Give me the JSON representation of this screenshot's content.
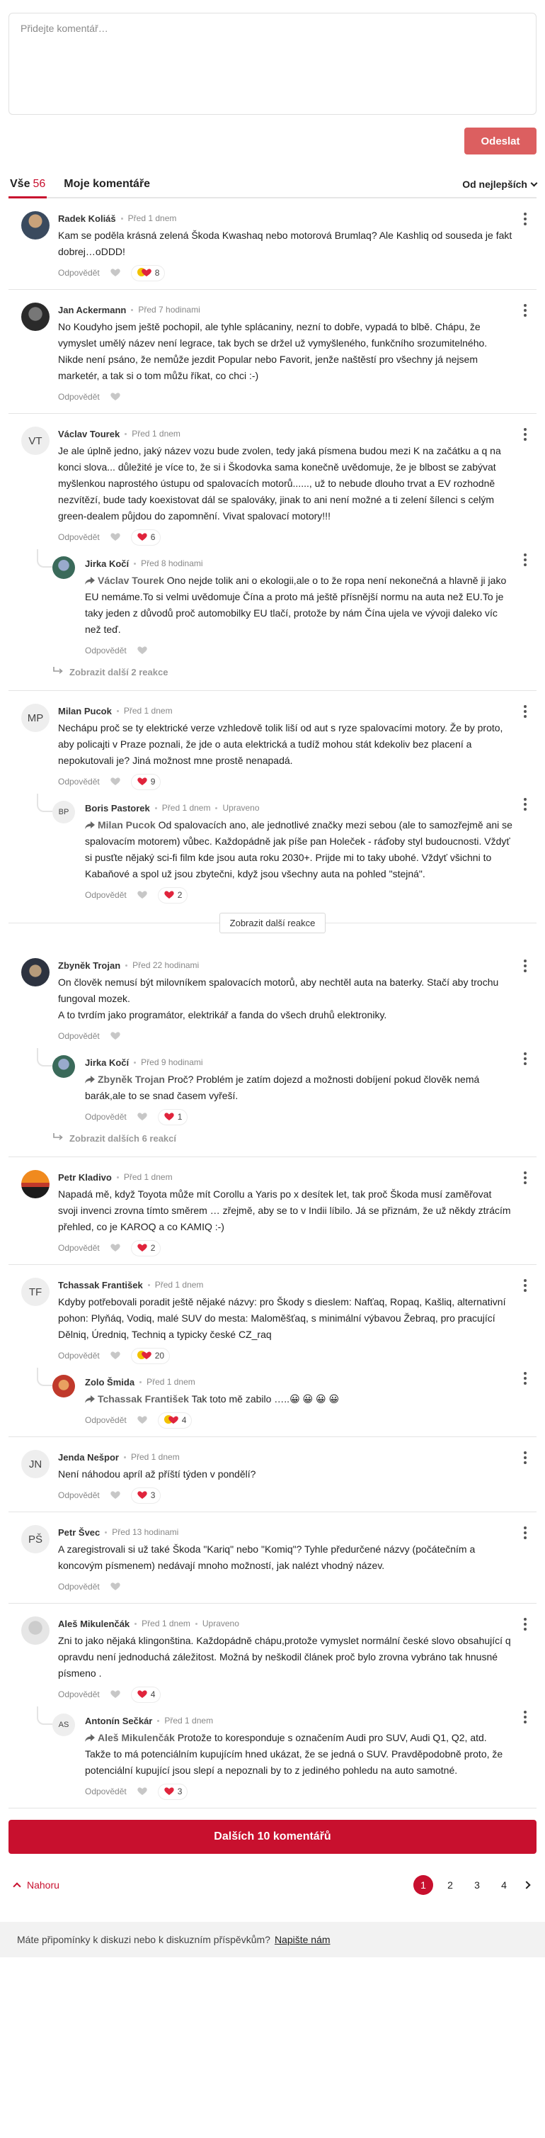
{
  "composer": {
    "placeholder": "Přidejte komentář…",
    "submit_label": "Odeslat"
  },
  "tabs": {
    "all_label": "Vše",
    "all_count": "56",
    "mine_label": "Moje komentáře",
    "sort_label": "Od nejlepších"
  },
  "labels": {
    "reply": "Odpovědět",
    "show_more_inline": "Zobrazit další reakce",
    "edited": "Upraveno"
  },
  "colors": {
    "accent": "#c8102e",
    "submit": "#dc5f60"
  },
  "comments": [
    {
      "author": "Radek Koliáš",
      "time": "Před 1 dnem",
      "text": "Kam se poděla krásná zelená Škoda Kwashaq nebo motorová Brumlaq? Ale Kashliq od souseda je fakt dobrej…oDDD!",
      "reaction": "8",
      "reaction_icon": "mixed"
    },
    {
      "author": "Jan Ackermann",
      "time": "Před 7 hodinami",
      "text": "No Koudyho jsem ještě pochopil, ale tyhle splácaniny, nezní to dobře, vypadá to blbě. Chápu, že vymyslet umělý název není legrace, tak bych se držel už vymyšleného, funkčního srozumitelného. Nikde není psáno, že nemůže jezdit Popular nebo Favorit, jenže naštěstí pro všechny já nejsem marketér, a tak si o tom můžu říkat, co chci :-)"
    },
    {
      "author": "Václav Tourek",
      "initials": "VT",
      "time": "Před 1 dnem",
      "text": "Je ale úplně jedno, jaký název vozu bude zvolen, tedy jaká písmena budou mezi K na začátku a q na konci slova... důležité je více to, že si i Škodovka sama konečně uvědomuje, že je blbost se zabývat myšlenkou naprostého ústupu od spalovacích motorů......, už to nebude dlouho trvat a EV rozhodně nezvítězí, bude tady koexistovat dál se spalováky, jinak to ani není možné a ti zelení šílenci s celým green-dealem půjdou do zapomnění. Vivat spalovací motory!!!",
      "reaction": "6"
    },
    {
      "author": "Jirka Kočí",
      "time": "Před 8 hodinami",
      "mention": "Václav Tourek",
      "text": "Ono nejde tolik ani o ekologii,ale o to že ropa není nekonečná a hlavně ji jako EU nemáme.To si velmi uvědomuje Čína a proto má ještě přísnější normu na auta než EU.To je taky jeden z důvodů proč automobilky EU tlačí, protože by nám Čína ujela ve vývoji daleko víc než teď.",
      "more": "Zobrazit další 2 reakce"
    },
    {
      "author": "Milan Pucok",
      "initials": "MP",
      "time": "Před 1 dnem",
      "text": "Nechápu proč se ty elektrické verze vzhledově tolik liší od aut s ryze spalovacími motory. Že by proto, aby policajti v Praze poznali, že jde o auta elektrická a tudíž mohou stát kdekoliv bez placení a nepokutovali je? Jiná možnost mne prostě nenapadá.",
      "reaction": "9"
    },
    {
      "author": "Boris Pastorek",
      "initials": "BP",
      "time": "Před 1 dnem",
      "mention": "Milan Pucok",
      "text": "Od spalovacích ano, ale jednotlivé značky mezi sebou (ale to samozřejmě ani se spalovacím motorem) vůbec. Každopádně jak píše pan Holeček - ráďoby styl budoucnosti. Vždyť si pusťte nějaký sci-fi film kde jsou auta roku 2030+. Prijde mi to taky ubohé. Vždyť všichni to Kabaňové a spol už jsou zbytečni, když jsou všechny auta na pohled \"stejná\".",
      "reaction": "2"
    },
    {
      "author": "Zbyněk Trojan",
      "time": "Před 22 hodinami",
      "text": "On člověk nemusí být milovníkem spalovacích motorů, aby nechtěl auta na baterky. Stačí aby trochu fungoval mozek.",
      "text2": "A to tvrdím jako programátor, elektrikář a fanda do všech druhů elektroniky."
    },
    {
      "author": "Jirka Kočí",
      "time": "Před 9 hodinami",
      "mention": "Zbyněk Trojan",
      "text": "Proč? Problém je zatím dojezd a možnosti dobíjení pokud člověk nemá barák,ale to se snad časem vyřeší.",
      "reaction": "1",
      "more": "Zobrazit dalších 6 reakcí"
    },
    {
      "author": "Petr Kladivo",
      "time": "Před 1 dnem",
      "text": "Napadá mě, když Toyota může mít Corollu a Yaris po x desítek let, tak proč Škoda musí zaměřovat svoji invenci zrovna tímto směrem … zřejmě, aby se to v Indii líbilo. Já se přiznám, že už někdy ztrácím přehled, co je KAROQ a co KAMIQ :-)",
      "reaction": "2"
    },
    {
      "author": "Tchassak František",
      "initials": "TF",
      "time": "Před 1 dnem",
      "text": "Kdyby potřebovali poradit ještě nějaké názvy: pro Škody s dieslem: Nafťaq, Ropaq, Kašliq, alternativní pohon: Plyňáq, Vodiq, malé SUV do mesta: Maloměšťaq, s minimální výbavou Žebraq, pro pracující Dělniq, Úredniq, Techniq a typicky české CZ_raq",
      "reaction": "20",
      "reaction_icon": "mixed"
    },
    {
      "author": "Zolo Šmida",
      "time": "Před 1 dnem",
      "mention": "Tchassak František",
      "text": "Tak toto mě zabilo …..😀 😀 😀 😀",
      "reaction": "4",
      "reaction_icon": "mixed"
    },
    {
      "author": "Jenda Nešpor",
      "initials": "JN",
      "time": "Před 1 dnem",
      "text": "Není náhodou apríl až příští týden v pondělí?",
      "reaction": "3"
    },
    {
      "author": "Petr Švec",
      "initials": "PŠ",
      "time": "Před 13 hodinami",
      "text": "A zaregistrovali si už také Škoda \"Kariq\" nebo \"Komiq\"? Tyhle předurčené názvy (počátečním a koncovým písmenem) nedávají mnoho možností, jak nalézt vhodný název."
    },
    {
      "author": "Aleš Mikulenčák",
      "time": "Před 1 dnem",
      "text": "Zni to jako nějaká klingonština. Každopádně chápu,protože vymyslet normální české slovo obsahující q opravdu není jednoduchá záležitost. Možná by neškodil článek proč bylo zrovna vybráno tak hnusné písmeno .",
      "reaction": "4"
    },
    {
      "author": "Antonín Sečkár",
      "initials": "AS",
      "time": "Před 1 dnem",
      "mention": "Aleš Mikulenčák",
      "text": "Protože to koresponduje s označením Audi pro SUV, Audi Q1, Q2, atd. Takže to má potenciálním kupujícím hned ukázat, že se jedná o SUV. Pravděpodobně proto, že potenciální kupující jsou slepí a nepoznali by to z jediného pohledu na auto samotné.",
      "reaction": "3"
    }
  ],
  "footer": {
    "load_more_label": "Dalších 10 komentářů",
    "back_top_label": "Nahoru",
    "pages": [
      "1",
      "2",
      "3",
      "4"
    ],
    "current_page": "1",
    "feedback_text": "Máte připomínky k diskuzi nebo k diskuzním příspěvkům?",
    "feedback_link": "Napište nám"
  }
}
